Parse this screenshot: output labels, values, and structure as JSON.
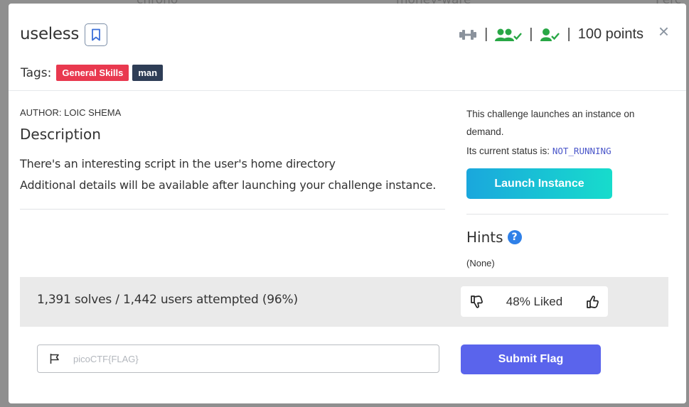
{
  "background": {
    "labels": [
      "chrono",
      "money-ware",
      "Perc"
    ]
  },
  "modal": {
    "title": "useless",
    "header": {
      "points": "100 points",
      "separator": "|",
      "icons": [
        "dumbbell-icon",
        "users-check-icon",
        "user-check-icon"
      ],
      "icon_color": "#28a745"
    },
    "close_label": "×",
    "tags": {
      "label": "Tags:",
      "items": [
        {
          "label": "General Skills",
          "color": "#e9394f"
        },
        {
          "label": "man",
          "color": "#2e3d56"
        }
      ]
    },
    "author": "AUTHOR: LOIC SHEMA",
    "description": {
      "heading": "Description",
      "lines": [
        "There's an interesting script in the user's home directory",
        "Additional details will be available after launching your challenge instance."
      ]
    },
    "instance": {
      "line1": "This challenge launches an instance on",
      "line2": "demand.",
      "status_label": "Its current status is:",
      "status_value": "NOT_RUNNING",
      "launch_label": "Launch Instance"
    },
    "hints": {
      "heading": "Hints",
      "help_glyph": "?",
      "value": "(None)"
    },
    "stats": {
      "solves_text": "1,391 solves / 1,442 users attempted (96%)",
      "liked_text": "48% Liked"
    },
    "flag": {
      "placeholder": "picoCTF{FLAG}",
      "submit_label": "Submit Flag"
    }
  },
  "colors": {
    "launch_gradient_start": "#1aa7dd",
    "launch_gradient_end": "#17dccc",
    "submit": "#5a64ec",
    "help": "#2f80e8"
  }
}
